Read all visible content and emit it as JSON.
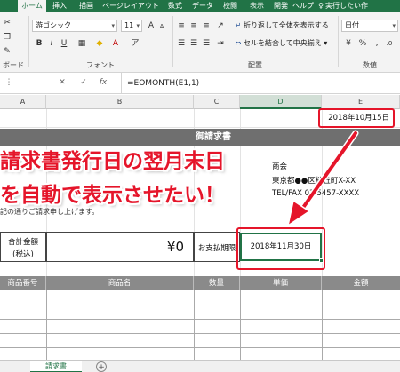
{
  "ribbon_tabs": [
    "ホーム",
    "挿入",
    "描画",
    "ページレイアウト",
    "数式",
    "データ",
    "校閲",
    "表示",
    "開発",
    "ヘルプ"
  ],
  "active_tab": "ホーム",
  "tell_me": "実行したい作",
  "font": {
    "name": "游ゴシック",
    "size": "11",
    "group_label": "フォント"
  },
  "alignment": {
    "wrap_text": "折り返して全体を表示する",
    "merge_center": "セルを結合して中央揃え",
    "group_label": "配置"
  },
  "number": {
    "format": "日付",
    "group_label": "数値"
  },
  "clipboard": {
    "group_label": "ボード"
  },
  "formula_bar": {
    "fx": "fx",
    "formula": "=EOMONTH(E1,1)"
  },
  "columns": [
    "A",
    "B",
    "C",
    "D",
    "E"
  ],
  "sheet": {
    "issue_date": "2018年10月15日",
    "title": "御請求書",
    "company": {
      "name": "商会",
      "address": "東京都●●区桜丘町X-XX",
      "tel": "TEL/FAX 03-5457-XXXX"
    },
    "note": "記の通りご請求申し上げます。",
    "total_label_1": "合計金額",
    "total_label_2": "(税込)",
    "total_amount": "¥0",
    "due_label": "お支払期限",
    "due_date": "2018年11月30日",
    "table_headers": [
      "商品番号",
      "商品名",
      "数量",
      "単価",
      "金額"
    ]
  },
  "annotation": {
    "line1": "請求書発行日の翌月末日",
    "line2": "を自動で表示させたい！"
  },
  "colors": {
    "excel_green": "#217346",
    "annotation_red": "#e5152a",
    "title_band": "#6f6f6f",
    "table_header": "#8a8a8a"
  },
  "sheet_tabs": [
    "請求書"
  ]
}
